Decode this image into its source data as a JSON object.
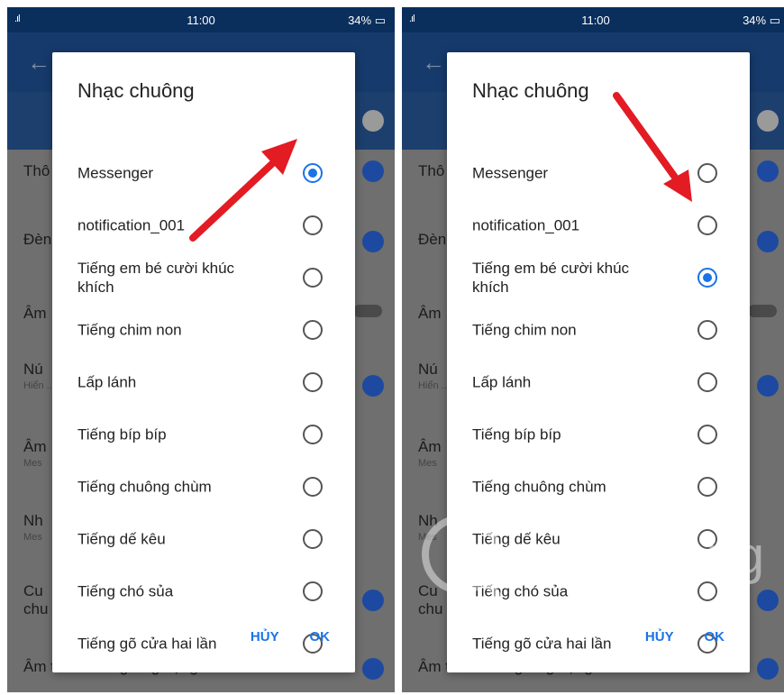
{
  "status": {
    "signal": ".ıl",
    "time": "11:00",
    "battery": "34%"
  },
  "background_rows": [
    {
      "label": "Thô"
    },
    {
      "label": "Đèn"
    },
    {
      "label": "Âm"
    },
    {
      "label": "Nú",
      "sub": "Hiển ... chư"
    },
    {
      "label": "Âm",
      "sub": "Mes"
    },
    {
      "label": "Nh",
      "sub": "Mes"
    },
    {
      "label": "Cu",
      "label2": "chu"
    },
    {
      "label": "Âm thanh trong ứng dụng"
    }
  ],
  "dialog": {
    "title": "Nhạc chuông",
    "options": [
      "Messenger",
      "notification_001",
      "Tiếng em bé cười khúc khích",
      "Tiếng chim non",
      "Lấp lánh",
      "Tiếng bíp bíp",
      "Tiếng chuông chùm",
      "Tiếng dế kêu",
      "Tiếng chó sủa",
      "Tiếng gõ cửa hai lần"
    ],
    "cancel": "HỦY",
    "ok": "OK"
  },
  "left_selected_index": 0,
  "right_selected_index": 2,
  "watermark": "uantrimang",
  "colors": {
    "accent": "#1a73e8",
    "arrow": "#e31b23",
    "statusbar": "#0b2f5c",
    "appbar": "#163a6b"
  }
}
